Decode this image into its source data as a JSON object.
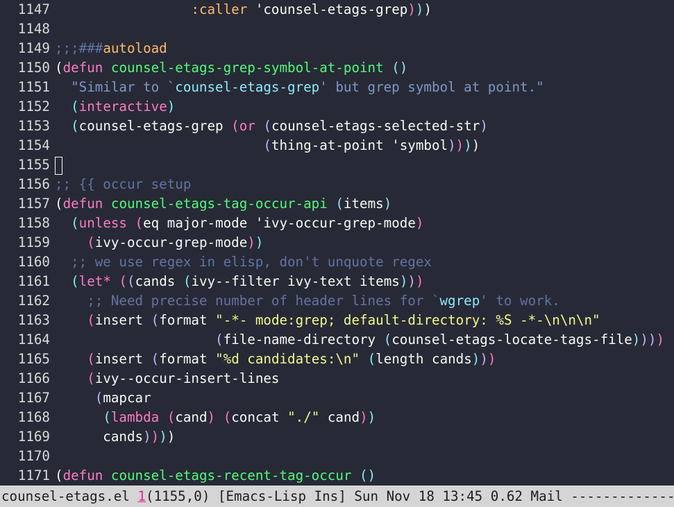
{
  "colors": {
    "background": "#272a36",
    "plain": "#f8f8f2",
    "keyword": "#ff79c6",
    "function_name": "#50fa7b",
    "comment": "#6272a4",
    "docstring": "#8096c8",
    "string": "#f1fa8c",
    "symbol": "#ffb86c",
    "reference": "#8be9fd",
    "modeline_bg": "#d5d5d5",
    "modeline_fg": "#1e1e1e",
    "modeline_number": "#e0289a"
  },
  "editor": {
    "lines": [
      {
        "num": "1147",
        "tokens": [
          {
            "t": "                 ",
            "c": "plain"
          },
          {
            "t": ":caller",
            "c": "symbol"
          },
          {
            "t": " 'counsel-etags-grep",
            "c": "plain"
          },
          {
            "t": ")",
            "c": "p3"
          },
          {
            "t": ")",
            "c": "p2"
          },
          {
            "t": ")",
            "c": "p1"
          }
        ]
      },
      {
        "num": "1148",
        "tokens": []
      },
      {
        "num": "1149",
        "tokens": [
          {
            "t": ";;;###",
            "c": "comment"
          },
          {
            "t": "autoload",
            "c": "symbol"
          }
        ]
      },
      {
        "num": "1150",
        "tokens": [
          {
            "t": "(",
            "c": "p1"
          },
          {
            "t": "defun",
            "c": "keyword"
          },
          {
            "t": " ",
            "c": "plain"
          },
          {
            "t": "counsel-etags-grep-symbol-at-point",
            "c": "function_name"
          },
          {
            "t": " ",
            "c": "plain"
          },
          {
            "t": "()",
            "c": "p2"
          }
        ]
      },
      {
        "num": "1151",
        "tokens": [
          {
            "t": "  \"Similar to `",
            "c": "docstring"
          },
          {
            "t": "counsel-etags-grep",
            "c": "reference"
          },
          {
            "t": "' but grep symbol at point.\"",
            "c": "docstring"
          }
        ]
      },
      {
        "num": "1152",
        "tokens": [
          {
            "t": "  ",
            "c": "plain"
          },
          {
            "t": "(",
            "c": "p2"
          },
          {
            "t": "interactive",
            "c": "keyword"
          },
          {
            "t": ")",
            "c": "p2"
          }
        ]
      },
      {
        "num": "1153",
        "tokens": [
          {
            "t": "  ",
            "c": "plain"
          },
          {
            "t": "(",
            "c": "p2"
          },
          {
            "t": "counsel-etags-grep ",
            "c": "plain"
          },
          {
            "t": "(",
            "c": "p3"
          },
          {
            "t": "or",
            "c": "keyword"
          },
          {
            "t": " ",
            "c": "plain"
          },
          {
            "t": "(",
            "c": "p4"
          },
          {
            "t": "counsel-etags-selected-str",
            "c": "plain"
          },
          {
            "t": ")",
            "c": "p4"
          }
        ]
      },
      {
        "num": "1154",
        "tokens": [
          {
            "t": "                          ",
            "c": "plain"
          },
          {
            "t": "(",
            "c": "p4"
          },
          {
            "t": "thing-at-point 'symbol",
            "c": "plain"
          },
          {
            "t": ")",
            "c": "p4"
          },
          {
            "t": ")",
            "c": "p3"
          },
          {
            "t": ")",
            "c": "p2"
          },
          {
            "t": ")",
            "c": "p1"
          }
        ]
      },
      {
        "num": "1155",
        "tokens": [],
        "cursor": true
      },
      {
        "num": "1156",
        "tokens": [
          {
            "t": ";; {{ occur setup",
            "c": "comment"
          }
        ]
      },
      {
        "num": "1157",
        "tokens": [
          {
            "t": "(",
            "c": "p1"
          },
          {
            "t": "defun",
            "c": "keyword"
          },
          {
            "t": " ",
            "c": "plain"
          },
          {
            "t": "counsel-etags-tag-occur-api",
            "c": "function_name"
          },
          {
            "t": " ",
            "c": "plain"
          },
          {
            "t": "(",
            "c": "p2"
          },
          {
            "t": "items",
            "c": "plain"
          },
          {
            "t": ")",
            "c": "p2"
          }
        ]
      },
      {
        "num": "1158",
        "tokens": [
          {
            "t": "  ",
            "c": "plain"
          },
          {
            "t": "(",
            "c": "p2"
          },
          {
            "t": "unless",
            "c": "keyword"
          },
          {
            "t": " ",
            "c": "plain"
          },
          {
            "t": "(",
            "c": "p3"
          },
          {
            "t": "eq major-mode 'ivy-occur-grep-mode",
            "c": "plain"
          },
          {
            "t": ")",
            "c": "p3"
          }
        ]
      },
      {
        "num": "1159",
        "tokens": [
          {
            "t": "    ",
            "c": "plain"
          },
          {
            "t": "(",
            "c": "p3"
          },
          {
            "t": "ivy-occur-grep-mode",
            "c": "plain"
          },
          {
            "t": ")",
            "c": "p3"
          },
          {
            "t": ")",
            "c": "p2"
          }
        ]
      },
      {
        "num": "1160",
        "tokens": [
          {
            "t": "  ;; we use regex in elisp, don't unquote regex",
            "c": "comment"
          }
        ]
      },
      {
        "num": "1161",
        "tokens": [
          {
            "t": "  ",
            "c": "plain"
          },
          {
            "t": "(",
            "c": "p2"
          },
          {
            "t": "let*",
            "c": "keyword"
          },
          {
            "t": " ",
            "c": "plain"
          },
          {
            "t": "(",
            "c": "p3"
          },
          {
            "t": "(",
            "c": "p4"
          },
          {
            "t": "cands ",
            "c": "plain"
          },
          {
            "t": "(",
            "c": "p5"
          },
          {
            "t": "ivy--filter ivy-text items",
            "c": "plain"
          },
          {
            "t": ")",
            "c": "p5"
          },
          {
            "t": ")",
            "c": "p4"
          },
          {
            "t": ")",
            "c": "p3"
          }
        ]
      },
      {
        "num": "1162",
        "tokens": [
          {
            "t": "    ;; Need precise number of header lines for `",
            "c": "comment"
          },
          {
            "t": "wgrep",
            "c": "reference"
          },
          {
            "t": "' to work.",
            "c": "comment"
          }
        ]
      },
      {
        "num": "1163",
        "tokens": [
          {
            "t": "    ",
            "c": "plain"
          },
          {
            "t": "(",
            "c": "p3"
          },
          {
            "t": "insert ",
            "c": "plain"
          },
          {
            "t": "(",
            "c": "p4"
          },
          {
            "t": "format ",
            "c": "plain"
          },
          {
            "t": "\"-*- mode:grep; default-directory: %S -*-\\n\\n\\n\"",
            "c": "string"
          }
        ]
      },
      {
        "num": "1164",
        "tokens": [
          {
            "t": "                    ",
            "c": "plain"
          },
          {
            "t": "(",
            "c": "p4"
          },
          {
            "t": "file-name-directory ",
            "c": "plain"
          },
          {
            "t": "(",
            "c": "p5"
          },
          {
            "t": "counsel-etags-locate-tags-file",
            "c": "plain"
          },
          {
            "t": ")",
            "c": "p5"
          },
          {
            "t": ")",
            "c": "p4"
          },
          {
            "t": ")",
            "c": "p4"
          },
          {
            "t": ")",
            "c": "p3"
          }
        ]
      },
      {
        "num": "1165",
        "tokens": [
          {
            "t": "    ",
            "c": "plain"
          },
          {
            "t": "(",
            "c": "p3"
          },
          {
            "t": "insert ",
            "c": "plain"
          },
          {
            "t": "(",
            "c": "p4"
          },
          {
            "t": "format ",
            "c": "plain"
          },
          {
            "t": "\"%d candidates:\\n\"",
            "c": "string"
          },
          {
            "t": " ",
            "c": "plain"
          },
          {
            "t": "(",
            "c": "p5"
          },
          {
            "t": "length cands",
            "c": "plain"
          },
          {
            "t": ")",
            "c": "p5"
          },
          {
            "t": ")",
            "c": "p4"
          },
          {
            "t": ")",
            "c": "p3"
          }
        ]
      },
      {
        "num": "1166",
        "tokens": [
          {
            "t": "    ",
            "c": "plain"
          },
          {
            "t": "(",
            "c": "p3"
          },
          {
            "t": "ivy--occur-insert-lines",
            "c": "plain"
          }
        ]
      },
      {
        "num": "1167",
        "tokens": [
          {
            "t": "     ",
            "c": "plain"
          },
          {
            "t": "(",
            "c": "p4"
          },
          {
            "t": "mapcar",
            "c": "plain"
          }
        ]
      },
      {
        "num": "1168",
        "tokens": [
          {
            "t": "      ",
            "c": "plain"
          },
          {
            "t": "(",
            "c": "p5"
          },
          {
            "t": "lambda",
            "c": "keyword"
          },
          {
            "t": " ",
            "c": "plain"
          },
          {
            "t": "(",
            "c": "p6"
          },
          {
            "t": "cand",
            "c": "plain"
          },
          {
            "t": ")",
            "c": "p6"
          },
          {
            "t": " ",
            "c": "plain"
          },
          {
            "t": "(",
            "c": "p6"
          },
          {
            "t": "concat ",
            "c": "plain"
          },
          {
            "t": "\"./\"",
            "c": "string"
          },
          {
            "t": " cand",
            "c": "plain"
          },
          {
            "t": ")",
            "c": "p6"
          },
          {
            "t": ")",
            "c": "p5"
          }
        ]
      },
      {
        "num": "1169",
        "tokens": [
          {
            "t": "      cands",
            "c": "plain"
          },
          {
            "t": ")",
            "c": "p4"
          },
          {
            "t": ")",
            "c": "p3"
          },
          {
            "t": ")",
            "c": "p2"
          },
          {
            "t": ")",
            "c": "p1"
          }
        ]
      },
      {
        "num": "1170",
        "tokens": []
      },
      {
        "num": "1171",
        "tokens": [
          {
            "t": "(",
            "c": "p1"
          },
          {
            "t": "defun",
            "c": "keyword"
          },
          {
            "t": " ",
            "c": "plain"
          },
          {
            "t": "counsel-etags-recent-tag-occur",
            "c": "function_name"
          },
          {
            "t": " ",
            "c": "plain"
          },
          {
            "t": "()",
            "c": "p2"
          }
        ]
      }
    ]
  },
  "modeline": {
    "filename": "counsel-etags.el",
    "window_number": "1",
    "position": "(1155,0)",
    "mode": "[Emacs-Lisp Ins]",
    "datetime": "Sun Nov 18 13:45",
    "load": "0.62",
    "mail": "Mail",
    "fill": "-------------------"
  }
}
